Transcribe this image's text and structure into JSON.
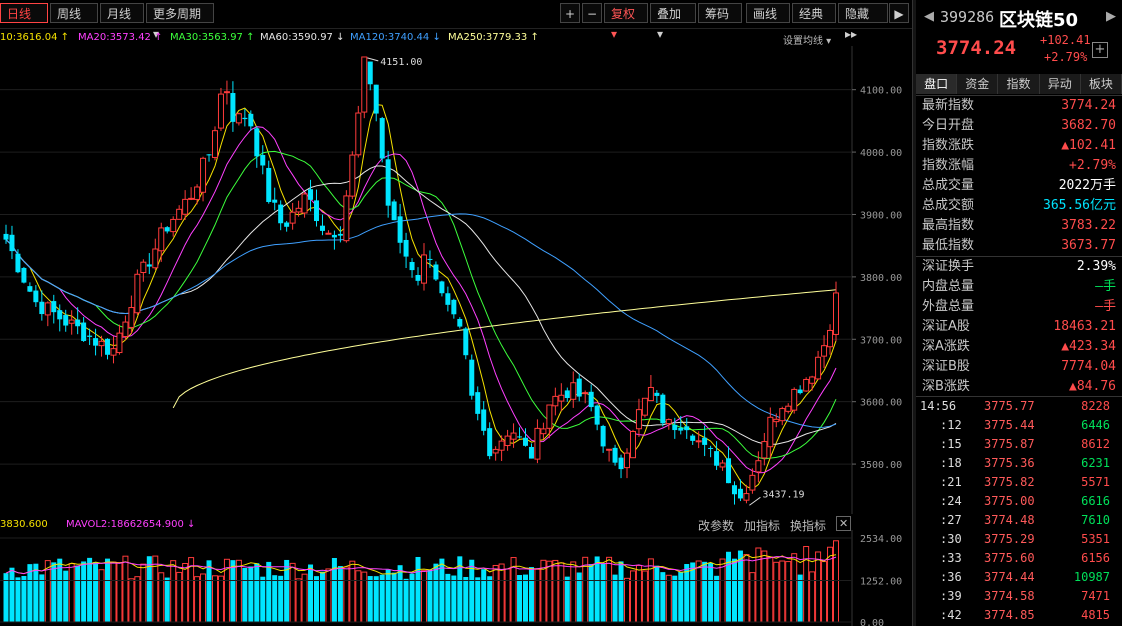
{
  "toolbar": {
    "periods": [
      "日线",
      "周线",
      "月线",
      "更多周期 ▾"
    ],
    "tools": [
      "+",
      "−",
      "复权 ▾",
      "叠加 ▾",
      "筹码",
      "画线",
      "经典",
      "隐藏 ▸▸"
    ]
  },
  "ma_legend": [
    {
      "text": "10:3616.04 ↑",
      "color": "#f5e100"
    },
    {
      "text": "MA20:3573.42 ↑",
      "color": "#ff40ff"
    },
    {
      "text": "MA30:3563.97 ↑",
      "color": "#3cff3c"
    },
    {
      "text": "MA60:3590.97 ↓",
      "color": "#e6e6e6"
    },
    {
      "text": "MA120:3740.44 ↓",
      "color": "#3fa0ff"
    },
    {
      "text": "MA250:3779.33 ↑",
      "color": "#ffff99"
    }
  ],
  "ma_settings": "设置均线 ▾",
  "vol_legend": {
    "vol": "3830.600",
    "mavol": "MAVOL2:18662654.900 ↓"
  },
  "vol_controls": [
    "改参数",
    "加指标",
    "换指标",
    "✕"
  ],
  "chart_data": {
    "type": "candlestick",
    "y_ticks": [
      "4100.00",
      "4000.00",
      "3900.00",
      "3800.00",
      "3700.00",
      "3600.00",
      "3500.00"
    ],
    "price_axis": {
      "min": 3420,
      "max": 4170
    },
    "last_price": 3774.24,
    "high_annotation": "4151.00",
    "low_annotation": "3437.19",
    "vol_ticks": [
      "2534.00",
      "1252.00",
      "0.00"
    ],
    "ma_colors": {
      "ma10": "#f5e100",
      "ma20": "#ff40ff",
      "ma30": "#3cff3c",
      "ma60": "#e6e6e6",
      "ma120": "#3fa0ff",
      "ma250": "#ffff99"
    }
  },
  "panel": {
    "code": "399286",
    "name": "区块链50",
    "last": "3774.24",
    "change": "+102.41",
    "pct": "+2.79%",
    "tabs": [
      "盘口",
      "资金",
      "指数",
      "异动",
      "板块"
    ],
    "rows": [
      {
        "k": "最新指数",
        "v": "3774.24",
        "c": "red"
      },
      {
        "k": "今日开盘",
        "v": "3682.70",
        "c": "red"
      },
      {
        "k": "指数涨跌",
        "v": "▲102.41",
        "c": "red"
      },
      {
        "k": "指数涨幅",
        "v": "+2.79%",
        "c": "red"
      },
      {
        "k": "总成交量",
        "v": "2022万手",
        "c": "white"
      },
      {
        "k": "总成交额",
        "v": "365.56亿元",
        "c": "cyan"
      },
      {
        "k": "最高指数",
        "v": "3783.22",
        "c": "red"
      },
      {
        "k": "最低指数",
        "v": "3673.77",
        "c": "red"
      },
      {
        "k": "深证换手",
        "v": "2.39%",
        "c": "white"
      },
      {
        "k": "内盘总量",
        "v": "—手",
        "c": "green"
      },
      {
        "k": "外盘总量",
        "v": "—手",
        "c": "red"
      },
      {
        "k": "深证A股",
        "v": "18463.21",
        "c": "red"
      },
      {
        "k": "深A涨跌",
        "v": "▲423.34",
        "c": "red"
      },
      {
        "k": "深证B股",
        "v": "7774.04",
        "c": "red"
      },
      {
        "k": "深B涨跌",
        "v": "▲84.76",
        "c": "red"
      }
    ],
    "ticks": [
      {
        "t": "14:56",
        "p": "3775.77",
        "q": "8228",
        "c": "red"
      },
      {
        "t": ":12",
        "p": "3775.44",
        "q": "6446",
        "c": "green"
      },
      {
        "t": ":15",
        "p": "3775.87",
        "q": "8612",
        "c": "red"
      },
      {
        "t": ":18",
        "p": "3775.36",
        "q": "6231",
        "c": "green"
      },
      {
        "t": ":21",
        "p": "3775.82",
        "q": "5571",
        "c": "red"
      },
      {
        "t": ":24",
        "p": "3775.00",
        "q": "6616",
        "c": "green"
      },
      {
        "t": ":27",
        "p": "3774.48",
        "q": "7610",
        "c": "green"
      },
      {
        "t": ":30",
        "p": "3775.29",
        "q": "5351",
        "c": "red"
      },
      {
        "t": ":33",
        "p": "3775.60",
        "q": "6156",
        "c": "red"
      },
      {
        "t": ":36",
        "p": "3774.44",
        "q": "10987",
        "c": "green"
      },
      {
        "t": ":39",
        "p": "3774.58",
        "q": "7471",
        "c": "red"
      },
      {
        "t": ":42",
        "p": "3774.85",
        "q": "4815",
        "c": "red"
      }
    ]
  }
}
